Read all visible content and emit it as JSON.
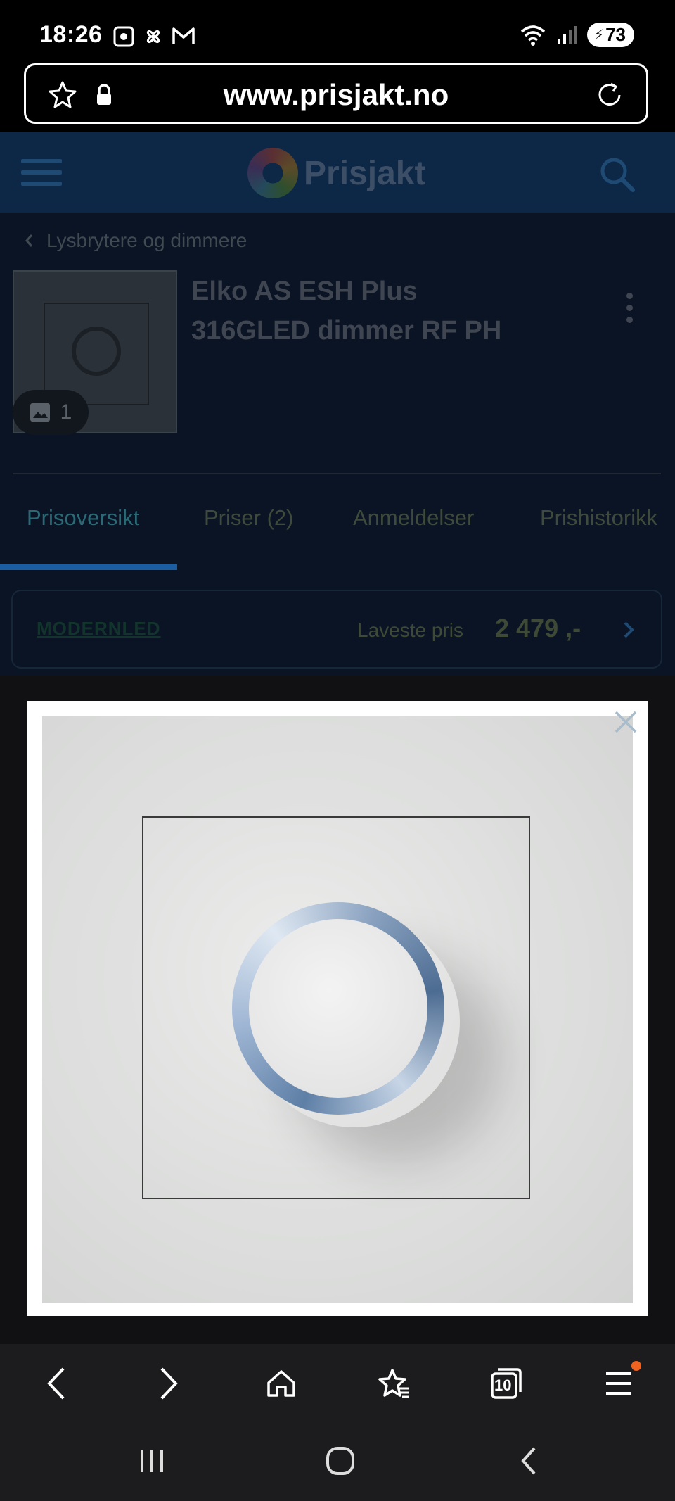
{
  "status_bar": {
    "time": "18:26",
    "battery": "73",
    "icons": [
      "screenshot-icon",
      "fan-icon",
      "gmail-icon",
      "wifi-icon",
      "signal-icon",
      "battery-icon"
    ]
  },
  "browser": {
    "url": "www.prisjakt.no",
    "tab_count": "10"
  },
  "site": {
    "logo_text": "Prisjakt"
  },
  "breadcrumb": {
    "label": "Lysbrytere og dimmere"
  },
  "product": {
    "title_line1": "Elko AS ESH Plus",
    "title_line2": "316GLED dimmer RF PH",
    "image_count": "1"
  },
  "tabs": [
    {
      "label": "Prisoversikt",
      "active": true
    },
    {
      "label": "Priser (2)",
      "active": false
    },
    {
      "label": "Anmeldelser",
      "active": false
    },
    {
      "label": "Prishistorikk",
      "active": false
    }
  ],
  "price_card": {
    "shop": "MODERNLED",
    "label": "Laveste pris",
    "price": "2 479 ,-"
  },
  "colors": {
    "header_bg": "#0d2747",
    "active_tab_underline": "#1a5da0",
    "notification_dot": "#f0621f"
  }
}
